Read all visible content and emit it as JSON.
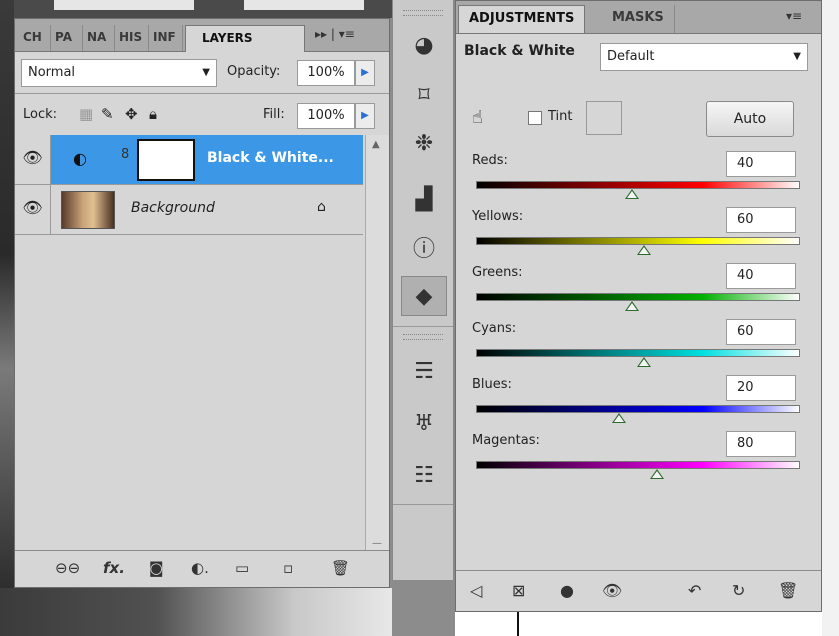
{
  "layers_panel": {
    "tabs": [
      "CH",
      "PA",
      "NA",
      "HIS",
      "INF",
      "LAYERS"
    ],
    "active_tab": "LAYERS",
    "tab_controls": "▸▸ | ▾≡",
    "blend_mode": "Normal",
    "opacity_label": "Opacity:",
    "opacity_value": "100%",
    "lock_label": "Lock:",
    "fill_label": "Fill:",
    "fill_value": "100%",
    "layers": [
      {
        "name": "Black & White...",
        "selected": true,
        "icon": "adjustment-layer-icon"
      },
      {
        "name": "Background",
        "selected": false,
        "icon": "photo-thumbnail"
      }
    ]
  },
  "dock": {
    "icons": [
      "color-icon",
      "transform-icon",
      "navigator-icon",
      "histogram-icon",
      "info-icon",
      "layers-icon",
      "brushes-icon",
      "tool-presets-icon",
      "actions-icon"
    ],
    "active": "layers-icon"
  },
  "adjustments_panel": {
    "tabs": [
      "ADJUSTMENTS",
      "MASKS"
    ],
    "active_tab": "ADJUSTMENTS",
    "title": "Black & White",
    "preset": "Default",
    "tint_label": "Tint",
    "auto_label": "Auto",
    "sliders": [
      {
        "label": "Reds:",
        "value": "40",
        "fraction": 0.48,
        "color": "#ff0000"
      },
      {
        "label": "Yellows:",
        "value": "60",
        "fraction": 0.52,
        "color": "#ffff00"
      },
      {
        "label": "Greens:",
        "value": "40",
        "fraction": 0.48,
        "color": "#00b000"
      },
      {
        "label": "Cyans:",
        "value": "60",
        "fraction": 0.52,
        "color": "#00e0e0"
      },
      {
        "label": "Blues:",
        "value": "20",
        "fraction": 0.44,
        "color": "#0000ff"
      },
      {
        "label": "Magentas:",
        "value": "80",
        "fraction": 0.56,
        "color": "#ff00ff"
      }
    ]
  }
}
